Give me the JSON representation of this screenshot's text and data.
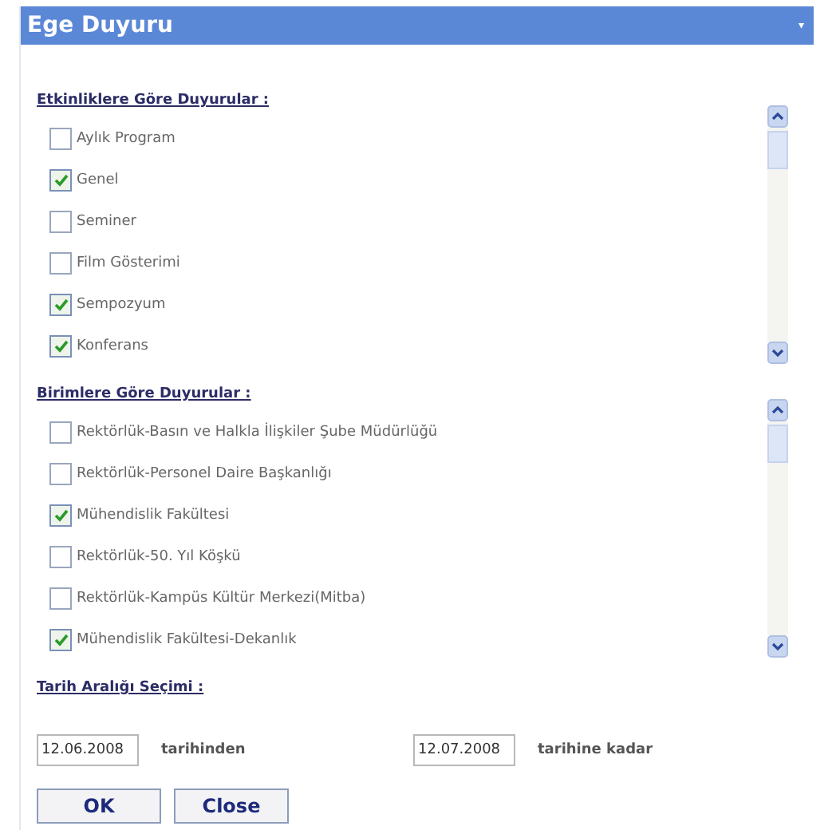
{
  "window": {
    "title": "Ege Duyuru",
    "menu_glyph": "▾"
  },
  "sections": [
    {
      "heading": "Etkinliklere Göre Duyurular :",
      "items": [
        {
          "label": "Aylık Program",
          "checked": false
        },
        {
          "label": "Genel",
          "checked": true
        },
        {
          "label": "Seminer",
          "checked": false
        },
        {
          "label": "Film Gösterimi",
          "checked": false
        },
        {
          "label": "Sempozyum",
          "checked": true
        },
        {
          "label": "Konferans",
          "checked": true
        }
      ]
    },
    {
      "heading": "Birimlere Göre Duyurular :",
      "items": [
        {
          "label": "Rektörlük-Basın ve Halkla İlişkiler Şube Müdürlüğü",
          "checked": false
        },
        {
          "label": "Rektörlük-Personel Daire Başkanlığı",
          "checked": false
        },
        {
          "label": "Mühendislik Fakültesi",
          "checked": true
        },
        {
          "label": "Rektörlük-50. Yıl Köşkü",
          "checked": false
        },
        {
          "label": "Rektörlük-Kampüs Kültür Merkezi(Mitba)",
          "checked": false
        },
        {
          "label": "Mühendislik Fakültesi-Dekanlık",
          "checked": true
        }
      ]
    }
  ],
  "date_range": {
    "heading": "Tarih Aralığı Seçimi :",
    "from_value": "12.06.2008",
    "from_label": "tarihinden",
    "to_value": "12.07.2008",
    "to_label": "tarihine kadar"
  },
  "buttons": [
    "OK",
    "Close"
  ]
}
